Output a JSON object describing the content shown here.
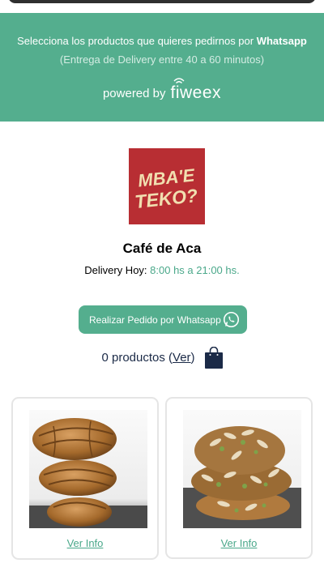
{
  "hero": {
    "line1_prefix": "Selecciona los productos que quieres pedirnos por ",
    "line1_bold": "Whatsapp",
    "line2": "(Entrega de Delivery entre 40 a 60 minutos)",
    "powered_by": "powered by",
    "brand": "fiweex"
  },
  "logo": {
    "line1": "MBA'E",
    "line2": "TEKO?"
  },
  "store": {
    "name": "Café de Aca",
    "delivery_label": "Delivery Hoy:",
    "delivery_hours": "8:00 hs a 21:00 hs."
  },
  "whatsapp_button": {
    "label": "Realizar Pedido por Whatsapp"
  },
  "cart": {
    "count_text": "0 productos (",
    "link": "Ver",
    "close": ")"
  },
  "products": [
    {
      "image": "croissant-stack-photo",
      "link": "Ver Info"
    },
    {
      "image": "almond-croissant-photo",
      "link": "Ver Info"
    }
  ],
  "colors": {
    "accent": "#54ae8e",
    "logo_bg": "#b82e33",
    "cart_text": "#1b2a47"
  }
}
